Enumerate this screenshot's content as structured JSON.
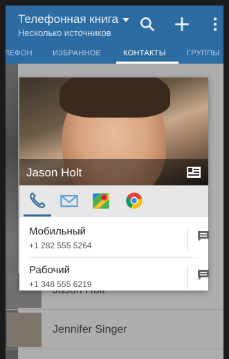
{
  "appbar": {
    "title": "Телефонная книга",
    "subtitle": "Несколько источников",
    "search_icon": "search-icon",
    "add_icon": "plus-icon",
    "menu_icon": "more-vert-icon"
  },
  "tabs": [
    {
      "label": "ЛЕФОН"
    },
    {
      "label": "ИЗБРАННОЕ"
    },
    {
      "label": "КОНТАКТЫ"
    },
    {
      "label": "ГРУППЫ"
    }
  ],
  "list": {
    "rows": [
      {
        "name": "Jason Holt"
      },
      {
        "name": "Jennifer Singer"
      }
    ]
  },
  "card": {
    "name": "Jason Holt",
    "actions": [
      "phone-icon",
      "email-icon",
      "maps-icon",
      "chrome-icon"
    ],
    "entries": [
      {
        "label": "Мобильный",
        "number": "+1 282 555 5264"
      },
      {
        "label": "Рабочий",
        "number": "+1 348 555 6219"
      }
    ]
  },
  "colors": {
    "accent": "#2d6ca3"
  }
}
